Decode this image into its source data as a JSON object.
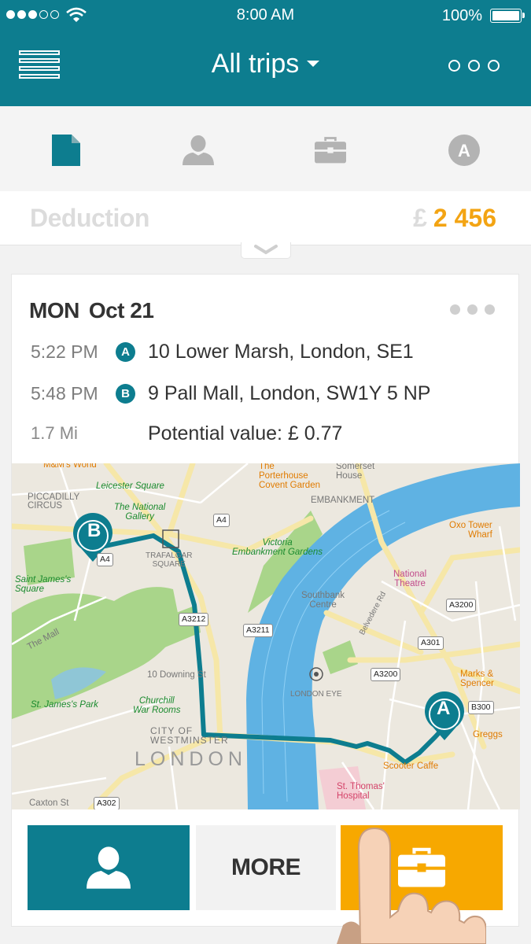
{
  "status_bar": {
    "time": "8:00 AM",
    "battery": "100%"
  },
  "nav": {
    "title": "All trips"
  },
  "summary": {
    "label": "Deduction",
    "currency": "£",
    "amount": "2 456"
  },
  "trip": {
    "day": "MON",
    "date": "Oct 21",
    "start": {
      "time": "5:22 PM",
      "marker": "A",
      "address": "10 Lower Marsh, London, SE1"
    },
    "end": {
      "time": "5:48 PM",
      "marker": "B",
      "address": "9 Pall Mall, London, SW1Y 5 NP"
    },
    "distance": "1.7 Mi",
    "value": "Potential value: £ 0.77"
  },
  "map": {
    "labels": {
      "mm": "M&M's World",
      "piccadilly": "PICCADILLY\nCIRCUS",
      "leicester": "Leicester Square",
      "gallery": "The National\nGallery",
      "trafalgar": "TRAFALGAR\nSQUARE",
      "porterhouse": "The\nPorterhouse\nCovent Garden",
      "somerset": "Somerset\nHouse",
      "embankment": "EMBANKMENT",
      "victoria": "Victoria\nEmbankment Gardens",
      "oxo": "Oxo Tower\nWharf",
      "stjsquare": "Saint James's\nSquare",
      "national_theatre": "National\nTheatre",
      "southbank": "Southbank\nCentre",
      "belvedere": "Belvedere Rd",
      "the_mall": "The Mall",
      "downing": "10 Downing St",
      "london_eye": "LONDON EYE",
      "marks": "Marks &\nSpencer",
      "stjpark": "St. James's Park",
      "churchill": "Churchill\nWar Rooms",
      "westminster": "CITY OF\nWESTMINSTER",
      "london": "LONDON",
      "greggs": "Greggs",
      "scooter": "Scooter Caffe",
      "thomas": "St. Thomas'\nHospital",
      "caxton": "Caxton St"
    },
    "roads": {
      "a4": "A4",
      "a4_2": "A4",
      "a3212": "A3212",
      "a3211": "A3211",
      "a3200": "A3200",
      "a3200_2": "A3200",
      "a301": "A301",
      "b300": "B300",
      "a302": "A302"
    },
    "markers": {
      "start": "A",
      "end": "B"
    },
    "route_color": "#0d7d8f"
  },
  "actions": {
    "more": "MORE"
  },
  "colors": {
    "teal": "#0d7d8f",
    "orange": "#f7a800",
    "amount": "#f3a413"
  },
  "icons": [
    "menu-icon",
    "caret-down-icon",
    "more-icon",
    "document-icon",
    "person-icon",
    "briefcase-icon",
    "auto-icon"
  ]
}
